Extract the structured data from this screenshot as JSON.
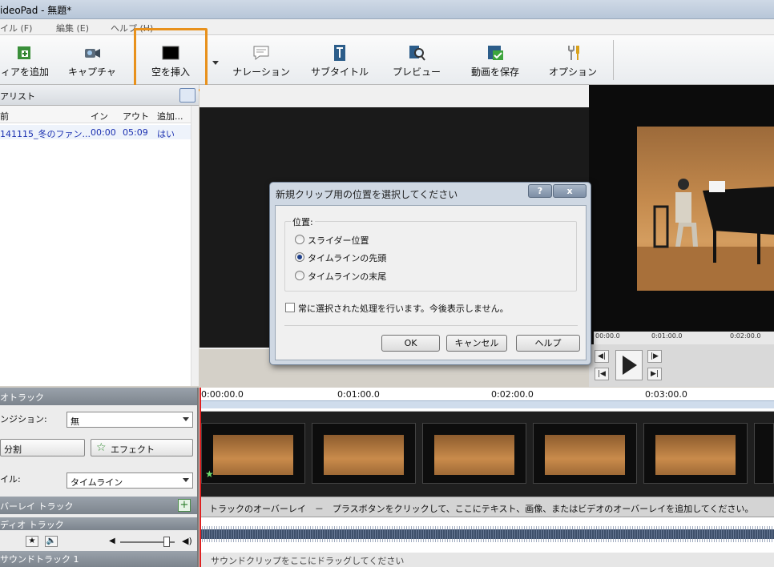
{
  "window": {
    "title": "ideoPad - 無題*"
  },
  "menu": {
    "file": "イル (F)",
    "edit": "編集 (E)",
    "help": "ヘルプ (H)"
  },
  "toolbar": {
    "add_media": "ィアを追加",
    "capture": "キャプチャ",
    "insert_blank": "空を挿入",
    "narration": "ナレーション",
    "subtitle": "サブタイトル",
    "preview": "プレビュー",
    "save_video": "動画を保存",
    "options": "オプション"
  },
  "media_panel": {
    "title": "アリスト",
    "columns": [
      "前",
      "イン",
      "アウト",
      "追加..."
    ],
    "rows": [
      {
        "name": "141115_冬のファン...",
        "in": "00:00",
        "out": "05:09",
        "added": "はい"
      }
    ]
  },
  "preview": {
    "ticks": [
      "00:00.0",
      "0:01:00.0",
      "0:02:00.0"
    ]
  },
  "timeline": {
    "ticks": [
      "0:00:00.0",
      "0:01:00.0",
      "0:02:00.0",
      "0:03:00.0"
    ],
    "video_track_label": "オトラック",
    "transition_label": "ンジション:",
    "transition_value": "無",
    "split_label": "分割",
    "effect_label": "エフェクト",
    "style_label": "イル:",
    "style_value": "タイムライン",
    "overlay_track_label": "バーレイ トラック",
    "audio_track_label": "ディオ トラック",
    "sound_track_label": "サウンドトラック 1",
    "overlay_hint": "トラックのオーバーレイ　－　プラスボタンをクリックして、ここにテキスト、画像、またはビデオのオーバーレイを追加してください。",
    "sound_hint": "サウンドクリップをここにドラッグしてください"
  },
  "dialog": {
    "title": "新規クリップ用の位置を選択してください",
    "help_glyph": "?",
    "close_glyph": "x",
    "group_label": "位置:",
    "options": [
      {
        "label": "スライダー位置",
        "selected": false
      },
      {
        "label": "タイムラインの先頭",
        "selected": true
      },
      {
        "label": "タイムラインの末尾",
        "selected": false
      }
    ],
    "checkbox_label": "常に選択された処理を行います。今後表示しません。",
    "ok": "OK",
    "cancel": "キャンセル",
    "help": "ヘルプ"
  },
  "colors": {
    "highlight": "#e8911c",
    "link": "#1a2fb0",
    "playhead": "#d22"
  }
}
